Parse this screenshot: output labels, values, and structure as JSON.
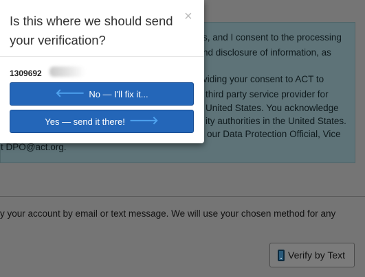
{
  "modal": {
    "title": "Is this where we should send your verification?",
    "close_glyph": "×",
    "phone_number": "1309692",
    "no_button": {
      "label": "No — I'll fix it...",
      "icon": "arrow-left-icon"
    },
    "yes_button": {
      "label": "Yes — send it there!",
      "icon": "arrow-right-icon"
    }
  },
  "background": {
    "notice_lines": [
      "s, and I consent to the processing",
      "nd disclosure of information, as",
      "viding your consent to ACT to",
      "third party service provider for",
      "United States. You acknowledge",
      "ity authorities in the United States.",
      "our Data Protection Official, Vice",
      "t DPO@act.org."
    ],
    "verify_instruction": "y your account by email or text message. We will use your chosen method for any",
    "verify_text_button": {
      "label": "Verify by Text",
      "icon": "mobile-phone-icon"
    }
  },
  "colors": {
    "overlay_page": "#757575",
    "notice_background": "#5e7378",
    "primary_button": "#2466b8",
    "arrow_accent": "#4fa3ef"
  }
}
